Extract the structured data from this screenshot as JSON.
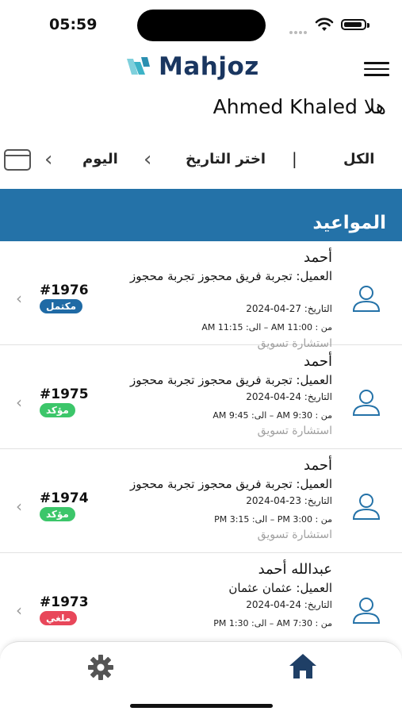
{
  "status_bar": {
    "time": "05:59"
  },
  "header": {
    "logo_text": "Mahjoz",
    "greeting": "هلا Ahmed Khaled"
  },
  "filters": {
    "all": "الكل",
    "separator": "|",
    "choose_date": "اختر التاريخ",
    "today": "اليوم"
  },
  "section": {
    "title": "المواعيد"
  },
  "appointments": [
    {
      "name": "أحمد",
      "client": "العميل: تجربة فريق محجوز تجربة محجوز",
      "date": "التاريخ: 27-04-2024",
      "time": "من : 11:00 AM – الى: 11:15 AM",
      "service": "استشارة تسويق",
      "number": "#1976",
      "status": "مكتمل",
      "status_color": "#1f6aa5"
    },
    {
      "name": "أحمد",
      "client": "العميل: تجربة فريق محجوز تجربة محجوز",
      "date": "التاريخ: 24-04-2024",
      "time": "من : 9:30 AM – الى: 9:45 AM",
      "service": "استشارة تسويق",
      "number": "#1975",
      "status": "مؤكد",
      "status_color": "#3cc66a"
    },
    {
      "name": "أحمد",
      "client": "العميل: تجربة فريق محجوز تجربة محجوز",
      "date": "التاريخ: 23-04-2024",
      "time": "من : 3:00 PM – الى: 3:15 PM",
      "service": "استشارة تسويق",
      "number": "#1974",
      "status": "مؤكد",
      "status_color": "#3cc66a"
    },
    {
      "name": "عبدالله أحمد",
      "client": "العميل: عثمان عثمان",
      "date": "التاريخ: 24-04-2024",
      "time": "من : 7:30 AM – الى: 1:30 PM",
      "service": "",
      "number": "#1973",
      "status": "ملغي",
      "status_color": "#e8475a"
    }
  ],
  "tabbar": {
    "settings_icon": "gear-icon",
    "home_icon": "home-icon"
  },
  "colors": {
    "brand": "#1a3660",
    "accent": "#2472a8"
  }
}
